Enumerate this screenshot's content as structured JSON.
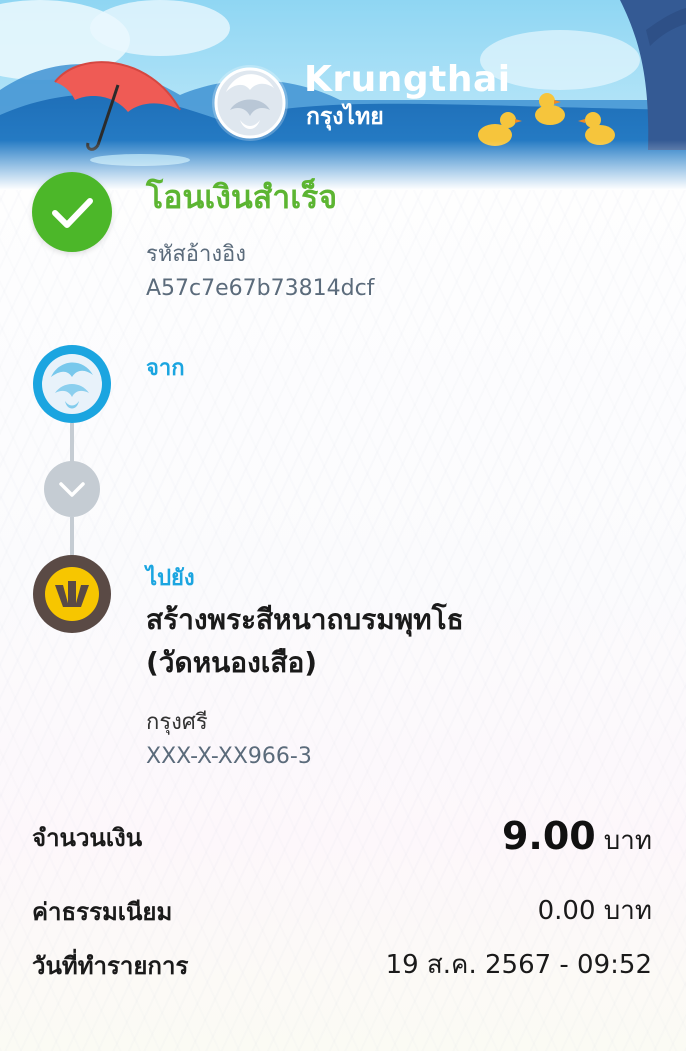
{
  "header": {
    "brand_name": "Krungthai",
    "brand_name_thai": "กรุงไทย",
    "logo_icon": "garuda-icon"
  },
  "status": {
    "title": "โอนเงินสำเร็จ",
    "reference_label": "รหัสอ้างอิง",
    "reference_value": "A57c7e67b73814dcf",
    "icon": "check-icon"
  },
  "from": {
    "label": "จาก",
    "icon": "krungthai-bank-icon"
  },
  "to": {
    "label": "ไปยัง",
    "name_line1": "สร้างพระสีหนาถบรมพุทโธ",
    "name_line2": "(วัดหนองเสือ)",
    "bank": "กรุงศรี",
    "account": "XXX-X-XX966-3",
    "icon": "krungsri-bank-icon"
  },
  "details": {
    "amount_label": "จำนวนเงิน",
    "amount_value": "9.00",
    "amount_unit": "บาท",
    "fee_label": "ค่าธรรมเนียม",
    "fee_value": "0.00 บาท",
    "date_label": "วันที่ทำรายการ",
    "date_value": "19 ส.ค. 2567 - 09:52"
  },
  "colors": {
    "success": "#4cb729",
    "accent_blue": "#1ba5e0",
    "krungsri_brown": "#5a4a45",
    "krungsri_yellow": "#f7c600",
    "connector_gray": "#c5ccd3"
  }
}
